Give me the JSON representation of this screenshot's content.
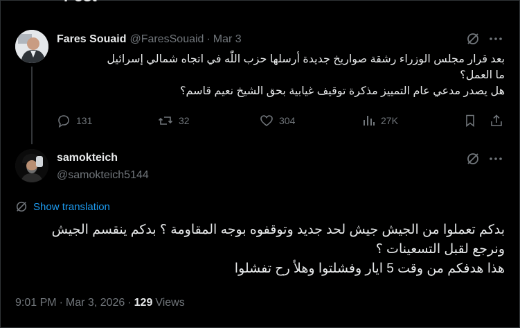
{
  "page_title": "Post",
  "parent_post": {
    "display_name": "Fares Souaid",
    "handle": "@FaresSouaid",
    "separator": "·",
    "date": "Mar 3",
    "text_lines": [
      "بعد قرار مجلس الوزراء رشقة صواريخ جديدة أرسلها حزب اللّٰه في اتجاه شمالي إسرائيل",
      "ما العمل؟",
      "هل يصدر مدعي عام التمييز مذكرة توقيف غيابية بحق الشيخ نعيم قاسم؟"
    ],
    "replies": "131",
    "reposts": "32",
    "likes": "304",
    "views": "27K"
  },
  "main_post": {
    "display_name": "samokteich",
    "handle": "@samokteich5144",
    "translate_label": "Show translation",
    "text_lines": [
      "بدكم تعملوا من الجيش جيش لحد جديد وتوقفوه بوجه المقاومة ؟ بدكم ينقسم الجيش",
      "ونرجع لقبل التسعينات ؟",
      "هذا هدفكم من وقت 5 ايار وفشلتوا وهلأ رح تفشلوا"
    ],
    "time": "9:01 PM",
    "date": "Mar 3, 2026",
    "separator": "·",
    "views_count": "129",
    "views_label": "Views"
  },
  "icons": [
    "grok-icon",
    "more-icon",
    "reply-icon",
    "repost-icon",
    "like-icon",
    "views-icon",
    "bookmark-icon",
    "share-icon",
    "translate-icon"
  ],
  "colors": {
    "background": "#000000",
    "text": "#e7e9ea",
    "muted": "#71767b",
    "link": "#1d9bf0",
    "border": "#2f3336"
  }
}
